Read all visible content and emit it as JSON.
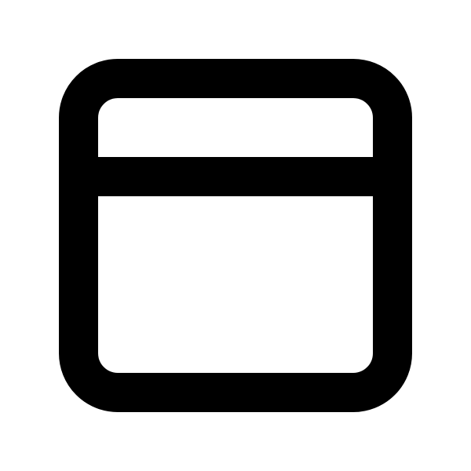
{
  "icon": {
    "name": "app-window-icon",
    "stroke_color": "#000000",
    "background_color": "#ffffff"
  }
}
